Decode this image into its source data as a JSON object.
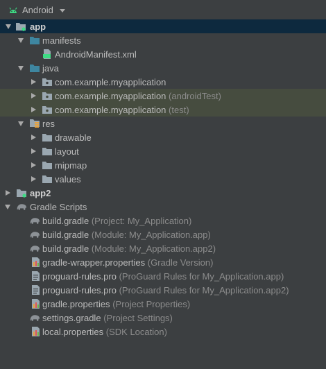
{
  "header": {
    "title": "Android"
  },
  "tree": [
    {
      "name": "app",
      "hint": ""
    },
    {
      "name": "manifests",
      "hint": ""
    },
    {
      "name": "AndroidManifest.xml",
      "hint": ""
    },
    {
      "name": "java",
      "hint": ""
    },
    {
      "name": "com.example.myapplication",
      "hint": ""
    },
    {
      "name": "com.example.myapplication",
      "hint": "(androidTest)"
    },
    {
      "name": "com.example.myapplication",
      "hint": "(test)"
    },
    {
      "name": "res",
      "hint": ""
    },
    {
      "name": "drawable",
      "hint": ""
    },
    {
      "name": "layout",
      "hint": ""
    },
    {
      "name": "mipmap",
      "hint": ""
    },
    {
      "name": "values",
      "hint": ""
    },
    {
      "name": "app2",
      "hint": ""
    },
    {
      "name": "Gradle Scripts",
      "hint": ""
    },
    {
      "name": "build.gradle",
      "hint": "(Project: My_Application)"
    },
    {
      "name": "build.gradle",
      "hint": "(Module: My_Application.app)"
    },
    {
      "name": "build.gradle",
      "hint": "(Module: My_Application.app2)"
    },
    {
      "name": "gradle-wrapper.properties",
      "hint": "(Gradle Version)"
    },
    {
      "name": "proguard-rules.pro",
      "hint": "(ProGuard Rules for My_Application.app)"
    },
    {
      "name": "proguard-rules.pro",
      "hint": "(ProGuard Rules for My_Application.app2)"
    },
    {
      "name": "gradle.properties",
      "hint": "(Project Properties)"
    },
    {
      "name": "settings.gradle",
      "hint": "(Project Settings)"
    },
    {
      "name": "local.properties",
      "hint": "(SDK Location)"
    }
  ]
}
